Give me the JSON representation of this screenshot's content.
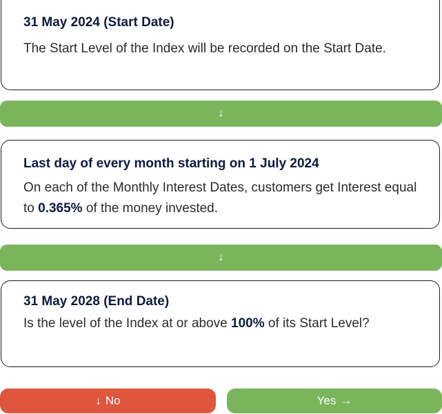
{
  "steps": [
    {
      "title": "31 May 2024 (Start Date)",
      "text": "The Start Level of the Index will be recorded on the Start Date."
    },
    {
      "title": "Last day of every month starting on 1 July 2024",
      "text_before": "On each of the Monthly Interest Dates, customers get Interest equal to ",
      "text_bold": "0.365%",
      "text_after": " of the money invested."
    },
    {
      "title": "31 May 2028 (End Date)",
      "text_before": "Is the level of the Index at or above ",
      "text_bold": "100%",
      "text_after": " of its Start Level?"
    }
  ],
  "connectors": {
    "arrow": "↓"
  },
  "outcomes": {
    "no_label": "No",
    "no_arrow": "↓",
    "yes_label": "Yes",
    "yes_arrow": "→"
  },
  "colors": {
    "green": "#7ab55c",
    "red": "#e0553e",
    "title_navy": "#0d1b3e"
  }
}
